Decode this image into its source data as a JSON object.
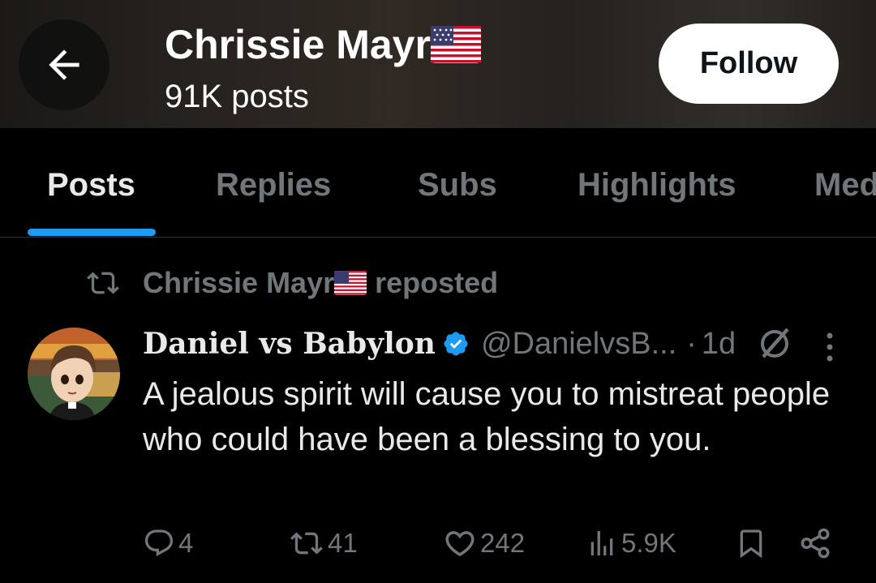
{
  "header": {
    "back_icon": "arrow-left-icon",
    "title": "Chrissie Mayr",
    "title_emoji": "us-flag",
    "post_count": "91K posts",
    "follow_label": "Follow"
  },
  "tabs": [
    {
      "label": "Posts",
      "active": true
    },
    {
      "label": "Replies",
      "active": false
    },
    {
      "label": "Subs",
      "active": false
    },
    {
      "label": "Highlights",
      "active": false
    },
    {
      "label": "Media",
      "active": false
    }
  ],
  "post": {
    "repost_icon": "repost-icon",
    "reposted_by": "Chrissie Mayr",
    "reposted_suffix": "reposted",
    "author_name": "Daniel vs Babylon",
    "verified": true,
    "handle": "@DanielvsB...",
    "separator": "·",
    "time": "1d",
    "text": "A jealous spirit will cause you to mistreat people who could have been a blessing to you.",
    "stats": {
      "replies": "4",
      "reposts": "41",
      "likes": "242",
      "views": "5.9K"
    }
  },
  "colors": {
    "background": "#000000",
    "accent": "#1d9bf0",
    "muted": "#71767b",
    "text": "#e7e9ea"
  }
}
